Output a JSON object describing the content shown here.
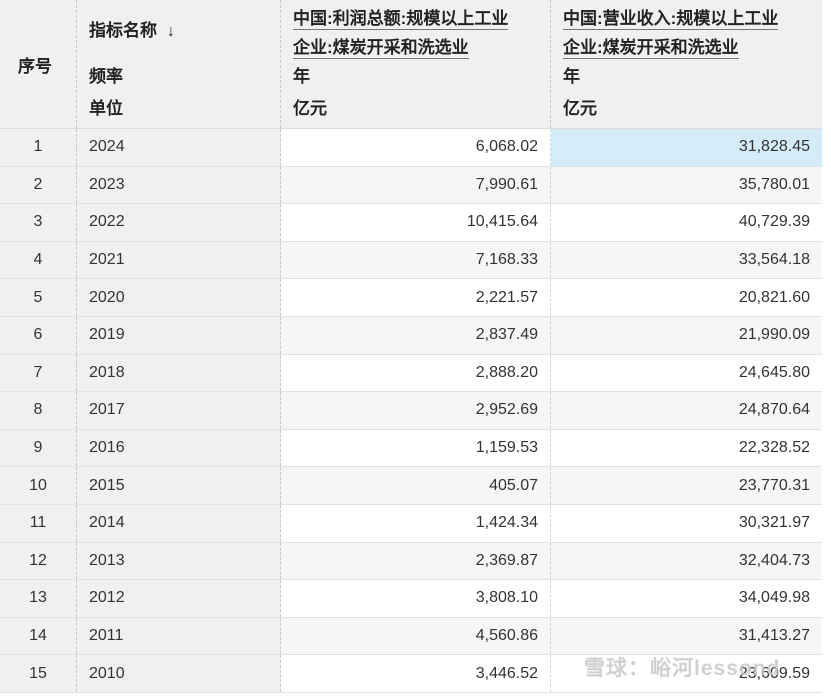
{
  "header": {
    "seq_label": "序号",
    "name_label": "指标名称",
    "sort_icon": "sort-down-arrow-icon",
    "sort_glyph": "↓",
    "freq_label": "频率",
    "unit_label": "单位",
    "indicators": [
      {
        "title_line1": "中国:利润总额:规模以上工业",
        "title_line2": "企业:煤炭开采和洗选业",
        "freq": "年",
        "unit": "亿元"
      },
      {
        "title_line1": "中国:营业收入:规模以上工业",
        "title_line2": "企业:煤炭开采和洗选业",
        "freq": "年",
        "unit": "亿元"
      }
    ]
  },
  "rows": [
    {
      "seq": "1",
      "year": "2024",
      "profit": "6,068.02",
      "revenue": "31,828.45"
    },
    {
      "seq": "2",
      "year": "2023",
      "profit": "7,990.61",
      "revenue": "35,780.01"
    },
    {
      "seq": "3",
      "year": "2022",
      "profit": "10,415.64",
      "revenue": "40,729.39"
    },
    {
      "seq": "4",
      "year": "2021",
      "profit": "7,168.33",
      "revenue": "33,564.18"
    },
    {
      "seq": "5",
      "year": "2020",
      "profit": "2,221.57",
      "revenue": "20,821.60"
    },
    {
      "seq": "6",
      "year": "2019",
      "profit": "2,837.49",
      "revenue": "21,990.09"
    },
    {
      "seq": "7",
      "year": "2018",
      "profit": "2,888.20",
      "revenue": "24,645.80"
    },
    {
      "seq": "8",
      "year": "2017",
      "profit": "2,952.69",
      "revenue": "24,870.64"
    },
    {
      "seq": "9",
      "year": "2016",
      "profit": "1,159.53",
      "revenue": "22,328.52"
    },
    {
      "seq": "10",
      "year": "2015",
      "profit": "405.07",
      "revenue": "23,770.31"
    },
    {
      "seq": "11",
      "year": "2014",
      "profit": "1,424.34",
      "revenue": "30,321.97"
    },
    {
      "seq": "12",
      "year": "2013",
      "profit": "2,369.87",
      "revenue": "32,404.73"
    },
    {
      "seq": "13",
      "year": "2012",
      "profit": "3,808.10",
      "revenue": "34,049.98"
    },
    {
      "seq": "14",
      "year": "2011",
      "profit": "4,560.86",
      "revenue": "31,413.27"
    },
    {
      "seq": "15",
      "year": "2010",
      "profit": "3,446.52",
      "revenue": "23,609.59"
    }
  ],
  "selected_cell": {
    "row": 0,
    "column": "revenue"
  },
  "watermark": {
    "text": "雪球：峪河lessond"
  },
  "colors": {
    "header_bg": "#f0f0f0",
    "selected_bg": "#d4ecf8",
    "grid_line": "#c8c8c8"
  }
}
